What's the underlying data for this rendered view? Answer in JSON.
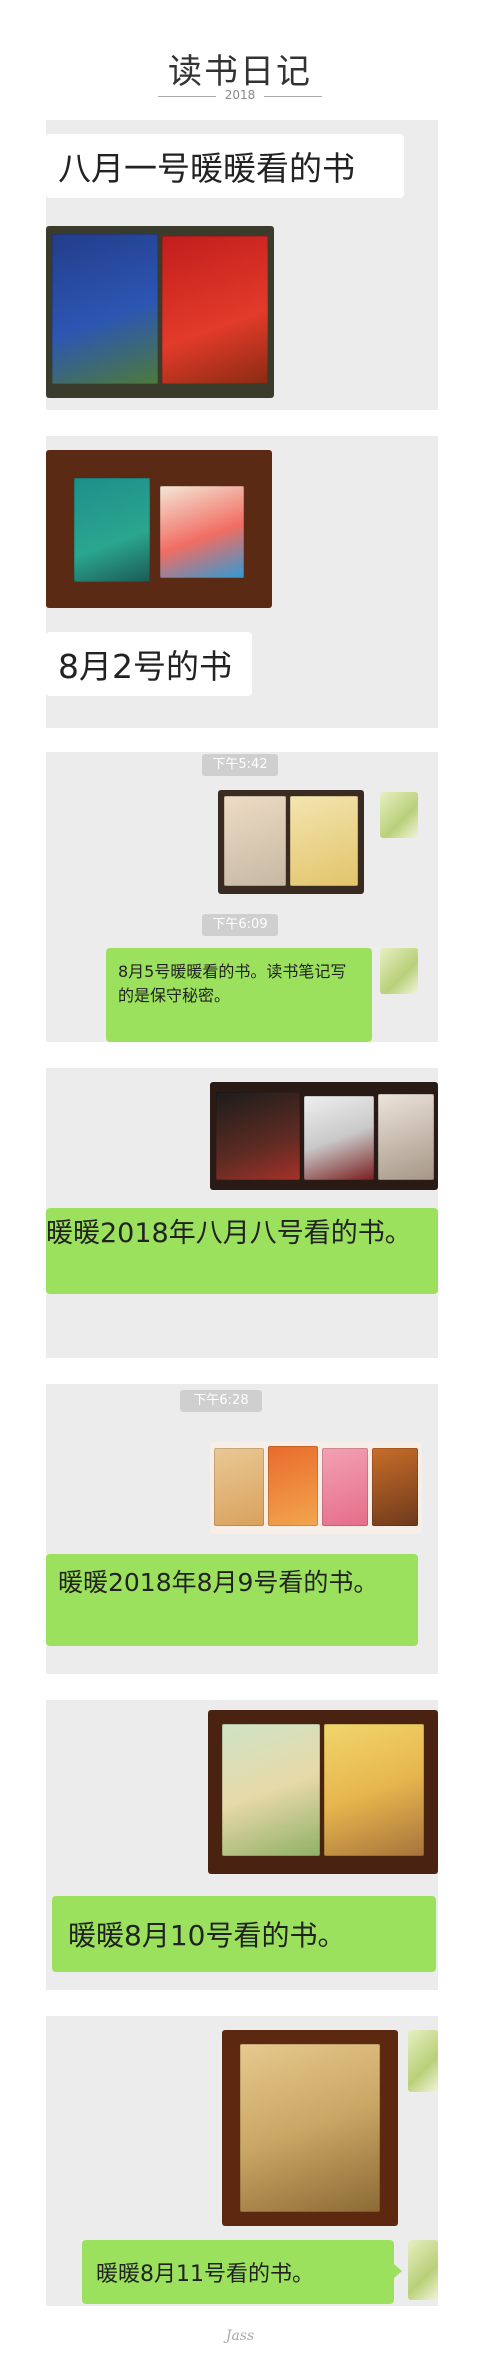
{
  "header": {
    "title": "读书日记",
    "year": "2018"
  },
  "posts": {
    "p1": {
      "caption": "八月一号暖暖看的书"
    },
    "p2": {
      "caption": "8月2号的书"
    },
    "p3": {
      "time1": "下午5:42",
      "time2": "下午6:09",
      "message": "8月5号暖暖看的书。读书笔记写的是保守秘密。"
    },
    "p4": {
      "message": "暖暖2018年八月八号看的书。"
    },
    "p5": {
      "time": "下午6:28",
      "message": "暖暖2018年8月9号看的书。"
    },
    "p6": {
      "message": "暖暖8月10号看的书。"
    },
    "p7": {
      "message": "暖暖8月11号看的书。"
    }
  },
  "footer": {
    "signature": "Jass"
  },
  "colors": {
    "panel": "#ececec",
    "green_bubble": "#9be15d",
    "photo_wood": "#5a2a14"
  }
}
